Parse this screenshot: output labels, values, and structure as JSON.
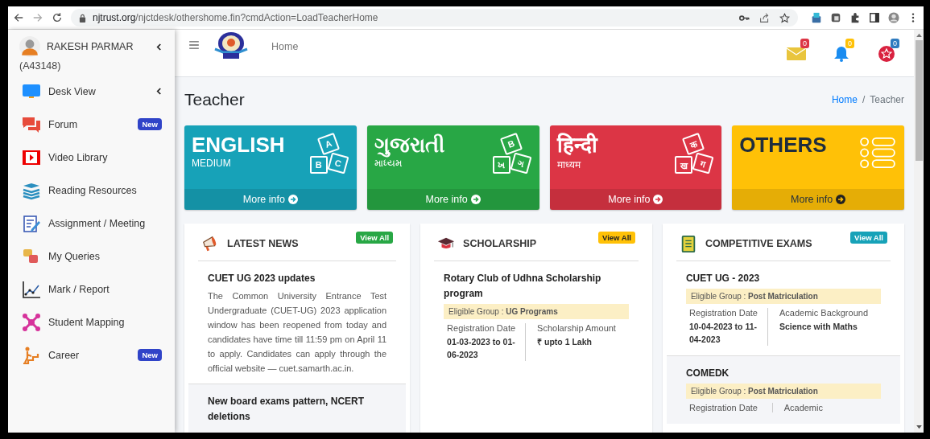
{
  "browser": {
    "url_host": "njtrust.org",
    "url_path": "/njctdesk/othershome.fin?cmdAction=LoadTeacherHome"
  },
  "sidebar": {
    "user": {
      "name": "RAKESH PARMAR",
      "id": "(A43148)"
    },
    "items": [
      {
        "label": "Desk View",
        "caret": true
      },
      {
        "label": "Forum",
        "badge": "New"
      },
      {
        "label": "Video Library"
      },
      {
        "label": "Reading Resources"
      },
      {
        "label": "Assignment / Meeting"
      },
      {
        "label": "My Queries"
      },
      {
        "label": "Mark / Report"
      },
      {
        "label": "Student Mapping"
      },
      {
        "label": "Career",
        "badge": "New"
      }
    ]
  },
  "navbar": {
    "home_link": "Home",
    "notifications": [
      {
        "kind": "mail",
        "count": "0",
        "color": "#dc3545"
      },
      {
        "kind": "bell",
        "count": "0",
        "color": "#ffc107"
      },
      {
        "kind": "star",
        "count": "0",
        "color": "#2f7bbf"
      }
    ]
  },
  "page": {
    "title": "Teacher",
    "breadcrumb": [
      "Home",
      "Teacher"
    ],
    "breadcrumb_separator": "/"
  },
  "tiles": [
    {
      "title": "ENGLISH",
      "subtitle": "MEDIUM",
      "link": "More info",
      "color": "#17a2b8",
      "kind": "blocks",
      "letters": [
        "A",
        "B",
        "C"
      ]
    },
    {
      "title": "ગુજરાતી",
      "subtitle": "માધ્યમ",
      "link": "More info",
      "color": "#28a745",
      "kind": "blocks",
      "letters": [
        "B",
        "ખ",
        "ગ"
      ]
    },
    {
      "title": "हिन्दी",
      "subtitle": "माध्यम",
      "link": "More info",
      "color": "#dc3545",
      "kind": "blocks",
      "letters": [
        "क",
        "ख",
        "ग"
      ]
    },
    {
      "title": "OTHERS",
      "link": "More info",
      "color": "#ffc107",
      "kind": "list"
    }
  ],
  "cards": [
    {
      "title": "LATEST NEWS",
      "view_all": {
        "label": "View All",
        "color": "#28a745"
      },
      "kind": "news",
      "items": [
        {
          "title": "CUET UG 2023 updates",
          "body": "The Common University Entrance Test Undergraduate (CUET-UG) 2023 application window has been reopened from today and candidates have time till 11:59 pm on April 11 to apply. Candidates can apply through the official website — cuet.samarth.ac.in.",
          "highlighted": false
        },
        {
          "title": "New board exams pattern, NCERT deletions",
          "highlighted": true
        }
      ]
    },
    {
      "title": "SCHOLARSHIP",
      "view_all": {
        "label": "View All",
        "color": "#ffc107"
      },
      "kind": "detail",
      "items": [
        {
          "title": "Rotary Club of Udhna Scholarship program",
          "eligible": "Eligible Group : **UG Programs**",
          "details": [
            {
              "label": "Registration Date",
              "value": "01-03-2023 to 01-06-2023"
            },
            {
              "label": "Scholarship Amount",
              "value": "₹ upto 1 Lakh"
            }
          ],
          "highlighted": false
        }
      ]
    },
    {
      "title": "COMPETITIVE EXAMS",
      "view_all": {
        "label": "View All",
        "color": "#17a2b8"
      },
      "kind": "detail",
      "items": [
        {
          "title": "CUET UG - 2023",
          "eligible": "Eligible Group : **Post Matriculation**",
          "details": [
            {
              "label": "Registration Date",
              "value": "10-04-2023 to 11-04-2023"
            },
            {
              "label": "Academic Background",
              "value": "Science with Maths"
            }
          ],
          "highlighted": false
        },
        {
          "title": "COMEDK",
          "eligible": "Eligible Group : **Post Matriculation**",
          "details": [
            {
              "label": "Registration Date"
            },
            {
              "label": "Academic"
            }
          ],
          "highlighted": true
        }
      ]
    }
  ]
}
